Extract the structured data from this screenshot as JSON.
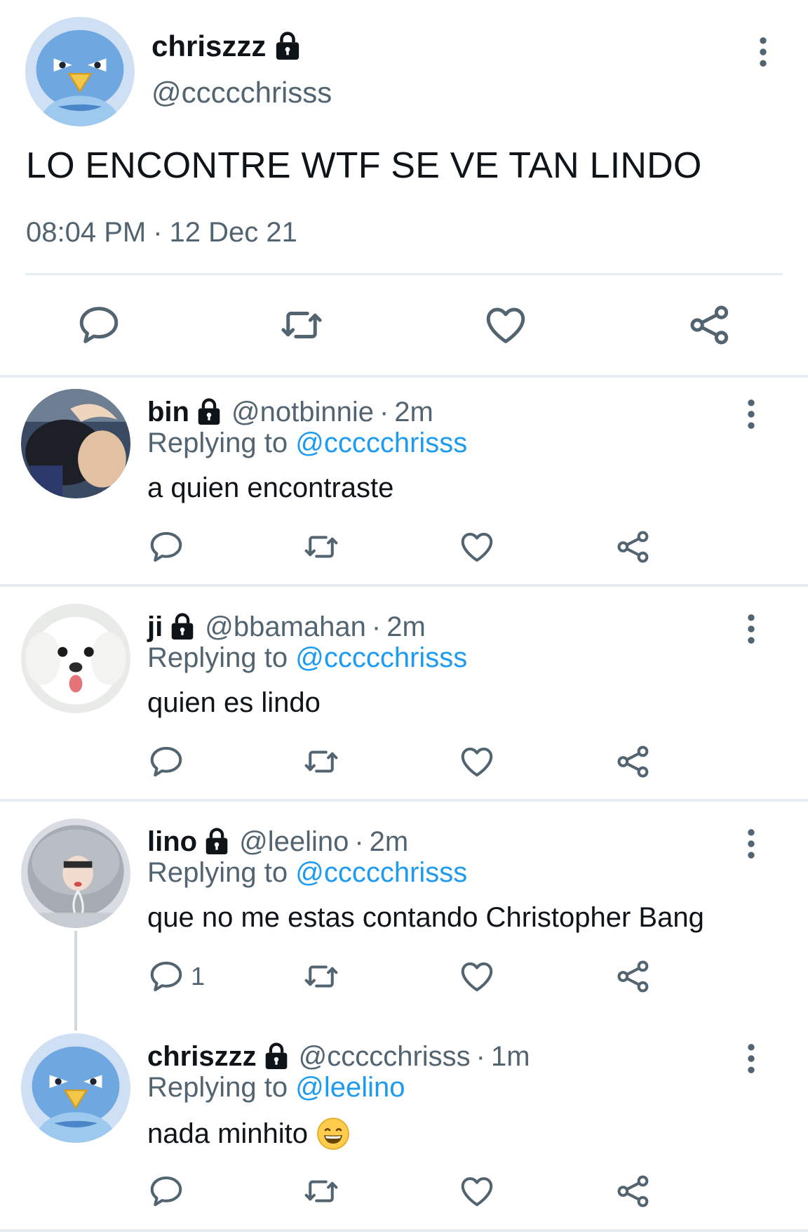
{
  "main_tweet": {
    "display_name": "chriszzz",
    "handle": "@ccccchrisss",
    "text": "LO ENCONTRE WTF SE VE TAN LINDO",
    "time": "08:04 PM",
    "date": "12 Dec 21",
    "separator": "·"
  },
  "replies": [
    {
      "display_name": "bin",
      "handle": "@notbinnie",
      "time": "2m",
      "replying_prefix": "Replying to ",
      "replying_to": "@ccccchrisss",
      "text": "a quien encontraste",
      "reply_count": ""
    },
    {
      "display_name": "ji",
      "handle": "@bbamahan",
      "time": "2m",
      "replying_prefix": "Replying to ",
      "replying_to": "@ccccchrisss",
      "text": "quien es lindo",
      "reply_count": ""
    },
    {
      "display_name": "lino",
      "handle": "@leelino",
      "time": "2m",
      "replying_prefix": "Replying to ",
      "replying_to": "@ccccchrisss",
      "text": "que no me estas contando Christopher Bang",
      "reply_count": "1"
    },
    {
      "display_name": "chriszzz",
      "handle": "@ccccchrisss",
      "time": "1m",
      "replying_prefix": "Replying to ",
      "replying_to": "@leelino",
      "text": "nada minhito",
      "reply_count": ""
    }
  ],
  "separator": "·",
  "icons": {
    "lock": "lock-icon",
    "more": "more-vertical-icon",
    "reply": "reply-icon",
    "retweet": "retweet-icon",
    "like": "heart-icon",
    "share": "share-icon",
    "emoji": "grinning-face-emoji"
  },
  "colors": {
    "text": "#0f1419",
    "secondary": "#536471",
    "link": "#1d9bf0",
    "divider": "#e6ecf0"
  }
}
